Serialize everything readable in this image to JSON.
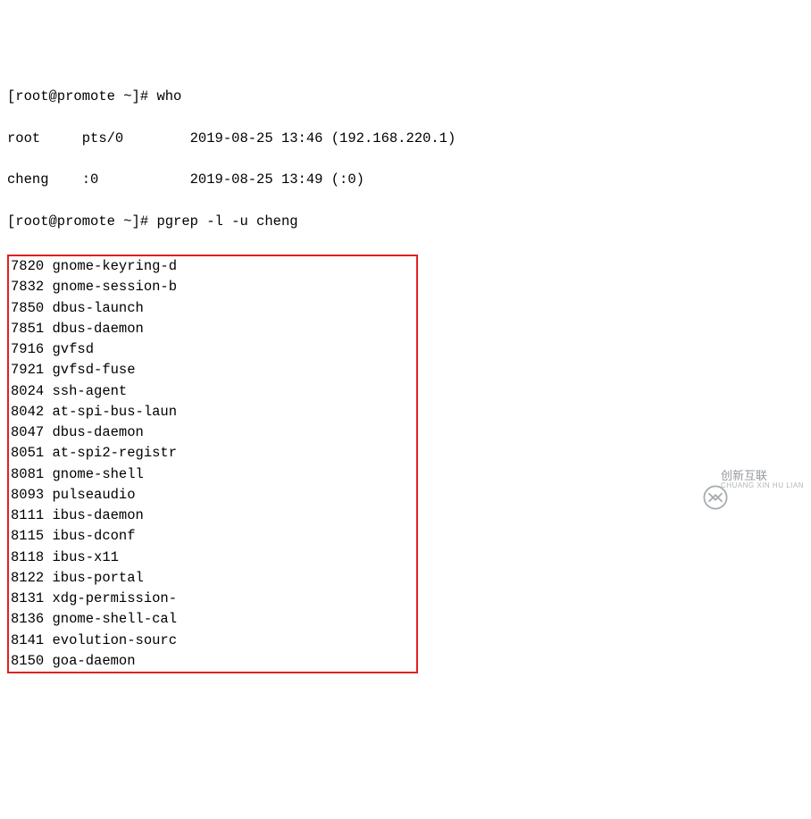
{
  "prompt1_prefix": "[root@promote ~]# ",
  "cmd1": "who",
  "who_lines": [
    "root     pts/0        2019-08-25 13:46 (192.168.220.1)",
    "cheng    :0           2019-08-25 13:49 (:0)"
  ],
  "prompt2_prefix": "[root@promote ~]# ",
  "cmd2": "pgrep -l -u cheng",
  "processes": [
    {
      "pid": "7820",
      "name": "gnome-keyring-d"
    },
    {
      "pid": "7832",
      "name": "gnome-session-b"
    },
    {
      "pid": "7850",
      "name": "dbus-launch"
    },
    {
      "pid": "7851",
      "name": "dbus-daemon"
    },
    {
      "pid": "7916",
      "name": "gvfsd"
    },
    {
      "pid": "7921",
      "name": "gvfsd-fuse"
    },
    {
      "pid": "8024",
      "name": "ssh-agent"
    },
    {
      "pid": "8042",
      "name": "at-spi-bus-laun"
    },
    {
      "pid": "8047",
      "name": "dbus-daemon"
    },
    {
      "pid": "8051",
      "name": "at-spi2-registr"
    },
    {
      "pid": "8081",
      "name": "gnome-shell"
    },
    {
      "pid": "8093",
      "name": "pulseaudio"
    },
    {
      "pid": "8111",
      "name": "ibus-daemon"
    },
    {
      "pid": "8115",
      "name": "ibus-dconf"
    },
    {
      "pid": "8118",
      "name": "ibus-x11"
    },
    {
      "pid": "8122",
      "name": "ibus-portal"
    },
    {
      "pid": "8131",
      "name": "xdg-permission-"
    },
    {
      "pid": "8136",
      "name": "gnome-shell-cal"
    },
    {
      "pid": "8141",
      "name": "evolution-sourc"
    },
    {
      "pid": "8150",
      "name": "goa-daemon"
    }
  ],
  "watermark": {
    "main": "创新互联",
    "sub": "CHUANG XIN HU LIAN"
  }
}
